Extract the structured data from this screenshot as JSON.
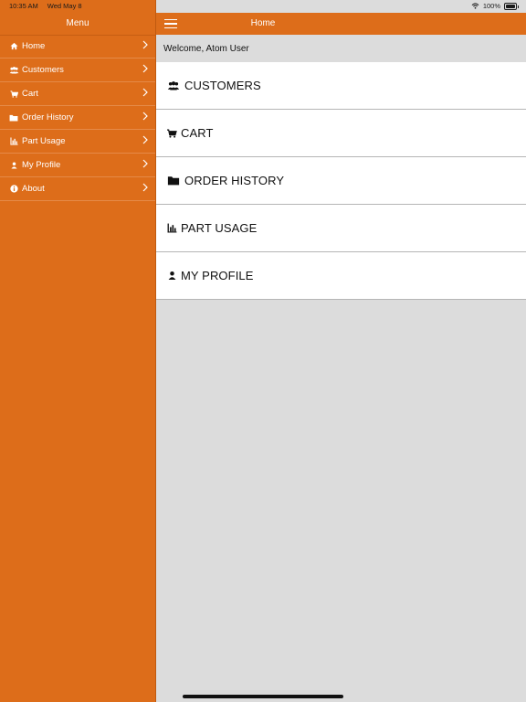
{
  "status": {
    "time": "10:35 AM",
    "date": "Wed May 8",
    "battery": "100%"
  },
  "colors": {
    "brand_orange": "#dd6d1a",
    "background": "#dcdcdc"
  },
  "sidebar": {
    "title": "Menu",
    "items": [
      {
        "label": "Home",
        "icon": "home-icon"
      },
      {
        "label": "Customers",
        "icon": "users-icon"
      },
      {
        "label": "Cart",
        "icon": "cart-icon"
      },
      {
        "label": "Order History",
        "icon": "folder-icon"
      },
      {
        "label": "Part Usage",
        "icon": "bar-chart-icon"
      },
      {
        "label": "My Profile",
        "icon": "user-icon"
      },
      {
        "label": "About",
        "icon": "info-icon"
      }
    ]
  },
  "header": {
    "title": "Home"
  },
  "main": {
    "welcome": "Welcome, Atom User",
    "tiles": [
      {
        "label": "CUSTOMERS",
        "icon": "users-icon"
      },
      {
        "label": "CART",
        "icon": "cart-icon"
      },
      {
        "label": "ORDER HISTORY",
        "icon": "folder-icon"
      },
      {
        "label": "PART USAGE",
        "icon": "bar-chart-icon"
      },
      {
        "label": "MY PROFILE",
        "icon": "user-icon"
      }
    ]
  }
}
